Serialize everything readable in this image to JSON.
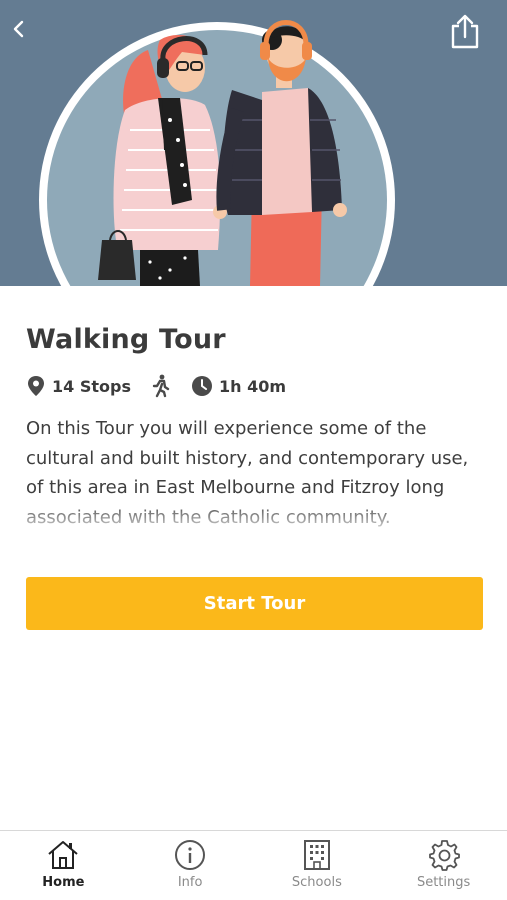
{
  "header": {
    "back_icon": "chevron-left-icon",
    "share_icon": "share-icon",
    "hero_background": "#647c92"
  },
  "tour": {
    "title": "Walking Tour",
    "stops": "14 Stops",
    "duration": "1h 40m",
    "description": "On this Tour you will experience some of the cultural and built history, and contemporary use, of this area in East Melbourne and Fitzroy long associated with the Catholic community.",
    "start_label": "Start Tour",
    "accent": "#fbb81a"
  },
  "tabs": [
    {
      "label": "Home",
      "icon": "home-icon",
      "active": true
    },
    {
      "label": "Info",
      "icon": "info-icon",
      "active": false
    },
    {
      "label": "Schools",
      "icon": "building-icon",
      "active": false
    },
    {
      "label": "Settings",
      "icon": "gear-icon",
      "active": false
    }
  ]
}
